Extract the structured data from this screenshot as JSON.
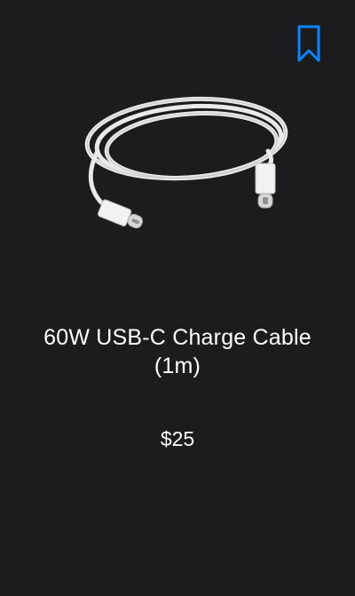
{
  "product": {
    "title": "60W USB-C Charge Cable (1m)",
    "price": "$25",
    "image_icon": "usb-c-cable-icon"
  },
  "actions": {
    "bookmark_icon": "bookmark-icon"
  },
  "colors": {
    "background": "#1c1c1e",
    "accent": "#0a84ff",
    "text": "#ffffff"
  }
}
